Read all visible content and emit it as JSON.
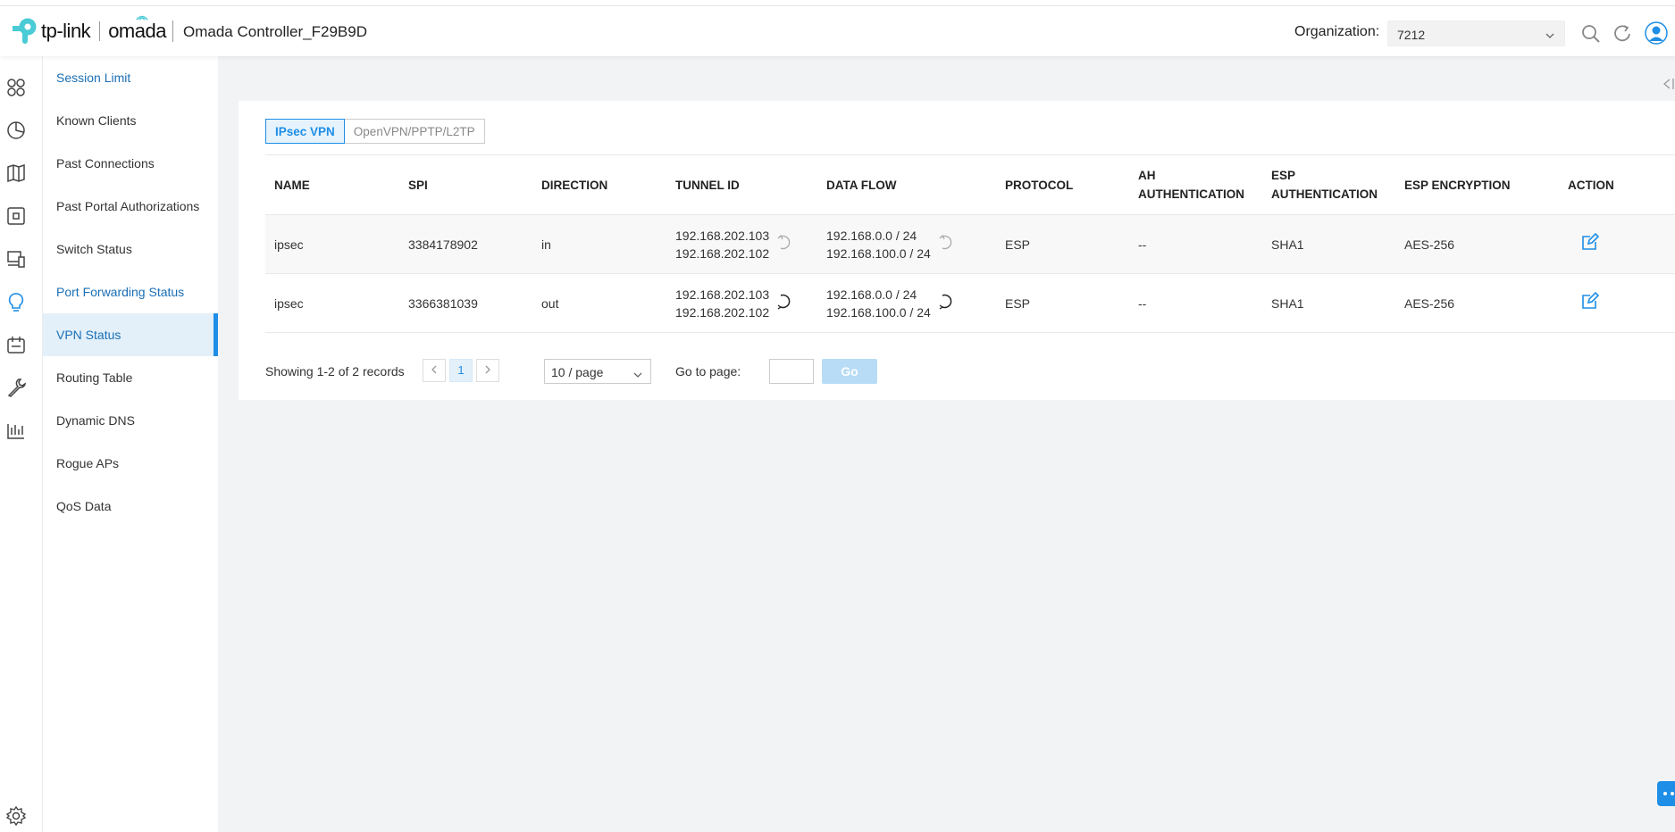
{
  "header": {
    "brand_tp": "tp-link",
    "brand_omada": "omada",
    "controller_name": "Omada Controller_F29B9D",
    "org_label": "Organization:",
    "org_value": "7212"
  },
  "nav_icons": [
    "dashboard-icon",
    "statistics-icon",
    "map-icon",
    "devices-icon",
    "clients-icon",
    "insight-icon",
    "logs-icon",
    "tools-icon",
    "reports-icon",
    "settings-icon"
  ],
  "submenu": {
    "items": [
      {
        "label": "Session Limit"
      },
      {
        "label": "Known Clients"
      },
      {
        "label": "Past Connections"
      },
      {
        "label": "Past Portal Authorizations"
      },
      {
        "label": "Switch Status"
      },
      {
        "label": "Port Forwarding Status"
      },
      {
        "label": "VPN Status"
      },
      {
        "label": "Routing Table"
      },
      {
        "label": "Dynamic DNS"
      },
      {
        "label": "Rogue APs"
      },
      {
        "label": "QoS Data"
      }
    ]
  },
  "tabs": [
    {
      "label": "IPsec VPN",
      "active": true
    },
    {
      "label": "OpenVPN/PPTP/L2TP",
      "active": false
    }
  ],
  "table": {
    "headers": {
      "name": "NAME",
      "spi": "SPI",
      "direction": "DIRECTION",
      "tunnel_id": "TUNNEL ID",
      "data_flow": "DATA FLOW",
      "protocol": "PROTOCOL",
      "ah_1": "AH",
      "ah_2": "AUTHENTICATION",
      "esp_auth_1": "ESP",
      "esp_auth_2": "AUTHENTICATION",
      "esp_enc": "ESP ENCRYPTION",
      "action": "ACTION"
    },
    "rows": [
      {
        "name": "ipsec",
        "spi": "3384178902",
        "direction": "in",
        "tunnel_a": "192.168.202.103",
        "tunnel_b": "192.168.202.102",
        "flow_a": "192.168.0.0 / 24",
        "flow_b": "192.168.100.0 / 24",
        "protocol": "ESP",
        "ah_auth": "--",
        "esp_auth": "SHA1",
        "esp_enc": "AES-256"
      },
      {
        "name": "ipsec",
        "spi": "3366381039",
        "direction": "out",
        "tunnel_a": "192.168.202.103",
        "tunnel_b": "192.168.202.102",
        "flow_a": "192.168.0.0 / 24",
        "flow_b": "192.168.100.0 / 24",
        "protocol": "ESP",
        "ah_auth": "--",
        "esp_auth": "SHA1",
        "esp_enc": "AES-256"
      }
    ]
  },
  "pagination": {
    "showing": "Showing 1-2 of 2 records",
    "prev": "<",
    "current_page": "1",
    "next": ">",
    "per_page": "10 / page",
    "goto_label": "Go to page:",
    "go_label": "Go"
  },
  "colors": {
    "accent": "#1e8ee6",
    "active_bg": "#e3f0fa",
    "main_bg": "#f2f3f5"
  }
}
